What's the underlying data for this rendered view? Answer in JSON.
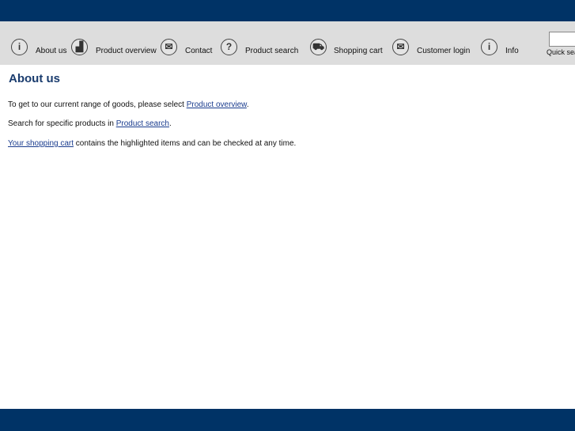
{
  "nav": {
    "items": [
      {
        "label": "About us",
        "icon": "info-icon",
        "glyph": "i"
      },
      {
        "label": "Product overview",
        "icon": "products-icon",
        "glyph": "▟"
      },
      {
        "label": "Contact",
        "icon": "envelope-icon",
        "glyph": "✉"
      },
      {
        "label": "Product search",
        "icon": "question-icon",
        "glyph": "?"
      },
      {
        "label": "Shopping cart",
        "icon": "cart-icon",
        "glyph": "⛟"
      },
      {
        "label": "Customer login",
        "icon": "envelope-icon",
        "glyph": "✉"
      },
      {
        "label": "Info",
        "icon": "info-icon",
        "glyph": "i"
      }
    ],
    "quick_search": {
      "label": "Quick search",
      "value": ""
    }
  },
  "main": {
    "title": "About us",
    "p1": {
      "before": "To get to our current range of goods, please select ",
      "link": "Product overview",
      "after": "."
    },
    "p2": {
      "before": "Search for specific products in ",
      "link": "Product search",
      "after": "."
    },
    "p3": {
      "link": "Your shopping cart",
      "after": " contains the highlighted items and can be checked at any time."
    }
  },
  "colors": {
    "brand": "#003366",
    "nav_bg": "#dddddd",
    "link": "#1a3c8e"
  }
}
